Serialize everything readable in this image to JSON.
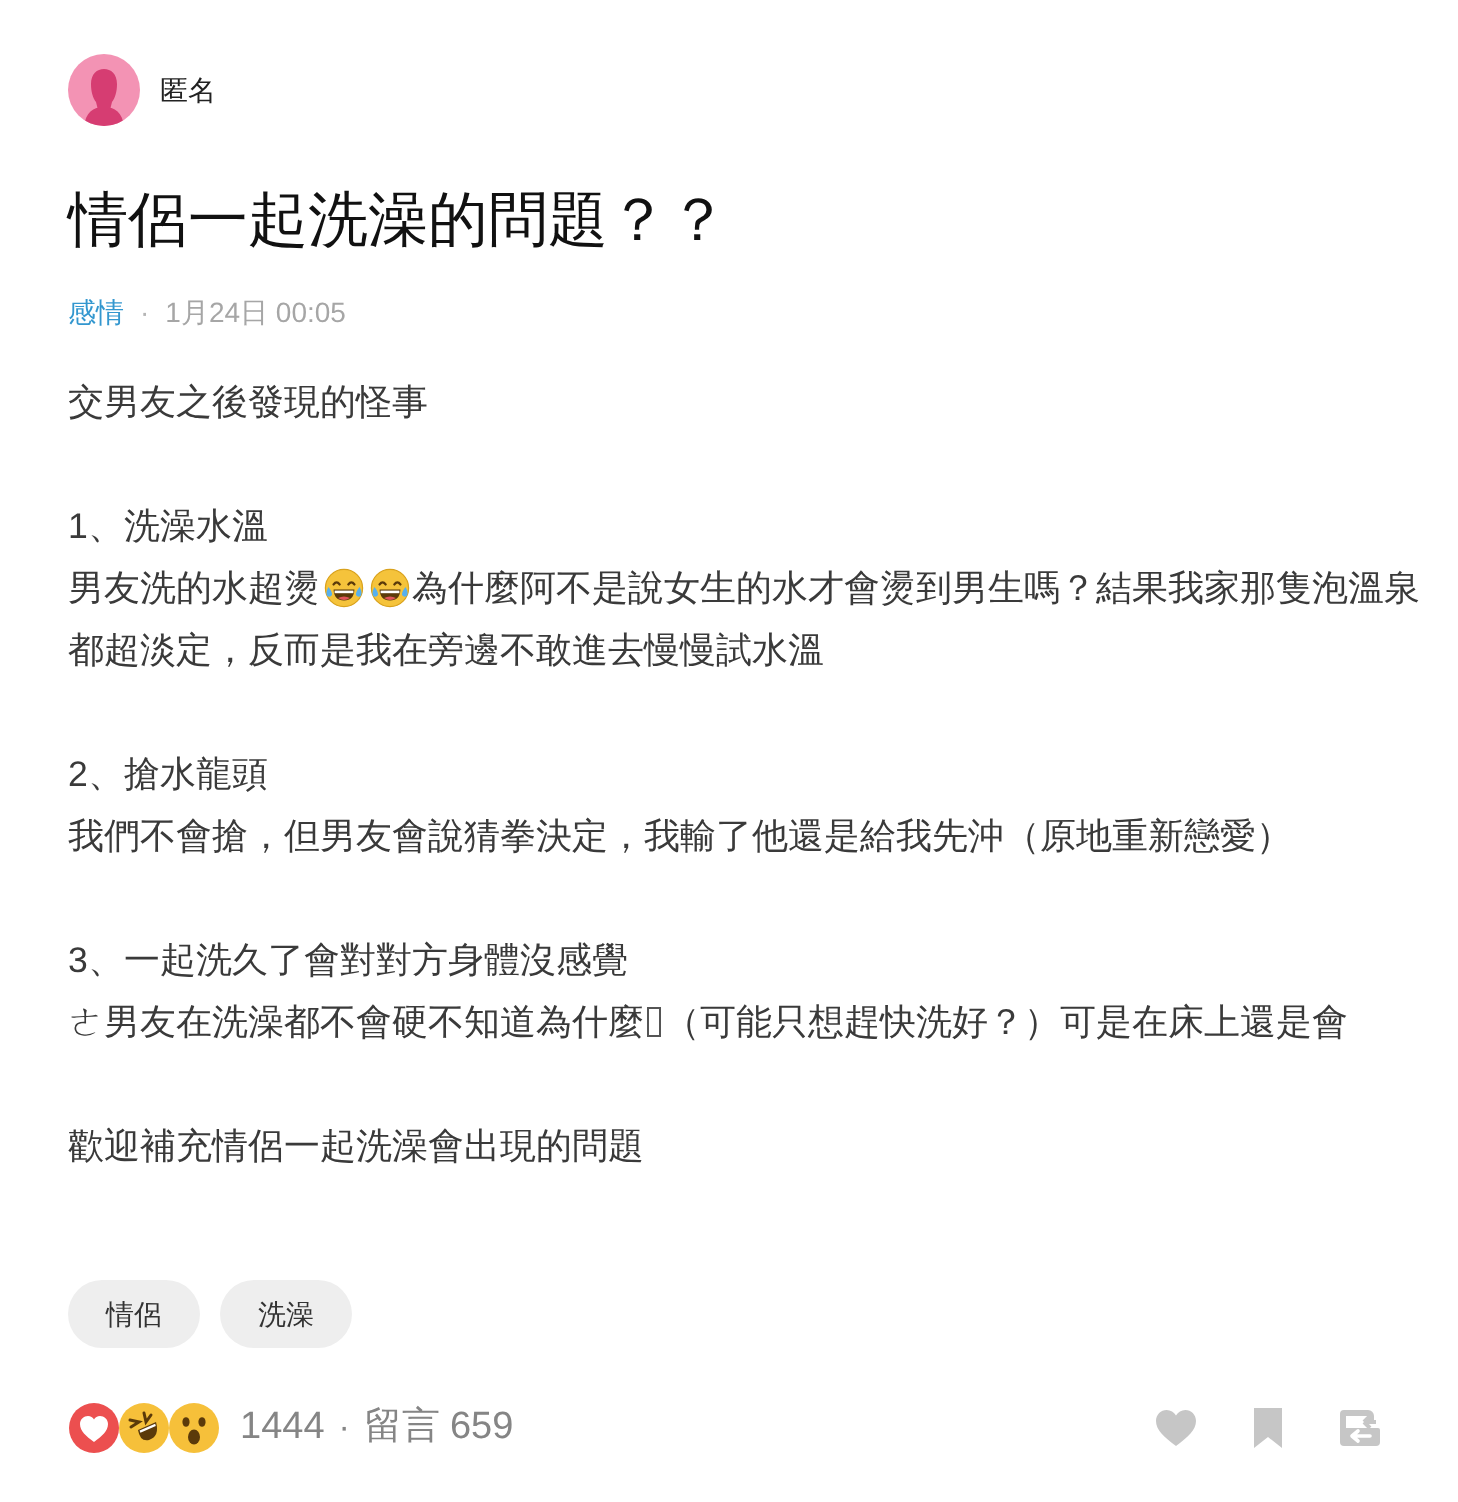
{
  "author": {
    "name": "匿名"
  },
  "post": {
    "title": "情侶一起洗澡的問題？？",
    "forum": "感情",
    "separator": "·",
    "time": "1月24日 00:05"
  },
  "paragraphs": [
    {
      "lines": [
        {
          "segments": [
            {
              "kind": "text",
              "text": "交男友之後發現的怪事"
            }
          ]
        }
      ]
    },
    {
      "lines": [
        {
          "segments": [
            {
              "kind": "text",
              "text": "1、洗澡水溫"
            }
          ]
        },
        {
          "segments": [
            {
              "kind": "text",
              "text": "男友洗的水超燙"
            },
            {
              "kind": "emoji"
            },
            {
              "kind": "emoji"
            },
            {
              "kind": "text",
              "text": "為什麼阿不是說女生的水才會燙到男生嗎？結果我家那隻泡溫泉"
            }
          ]
        },
        {
          "segments": [
            {
              "kind": "text",
              "text": "都超淡定，反而是我在旁邊不敢進去慢慢試水溫"
            }
          ]
        }
      ]
    },
    {
      "lines": [
        {
          "segments": [
            {
              "kind": "text",
              "text": "2、搶水龍頭"
            }
          ]
        },
        {
          "segments": [
            {
              "kind": "text",
              "text": "我們不會搶，但男友會說猜拳決定，我輸了他還是給我先沖（原地重新戀愛）"
            }
          ]
        }
      ]
    },
    {
      "lines": [
        {
          "segments": [
            {
              "kind": "text",
              "text": "3、一起洗久了會對對方身體沒感覺"
            }
          ]
        },
        {
          "segments": [
            {
              "kind": "text",
              "text": "ㄜ男友在洗澡都不會硬不知道為什麼"
            },
            {
              "kind": "missing_glyph"
            },
            {
              "kind": "text",
              "text": "（可能只想趕快洗好？）可是在床上還是會"
            }
          ]
        }
      ]
    },
    {
      "lines": [
        {
          "segments": [
            {
              "kind": "text",
              "text": "歡迎補充情侶一起洗澡會出現的問題"
            }
          ]
        }
      ]
    }
  ],
  "tags": [
    "情侶",
    "洗澡"
  ],
  "stats": {
    "reactions": "1444",
    "separator": "·",
    "comments_label": "留言",
    "comments": "659"
  }
}
